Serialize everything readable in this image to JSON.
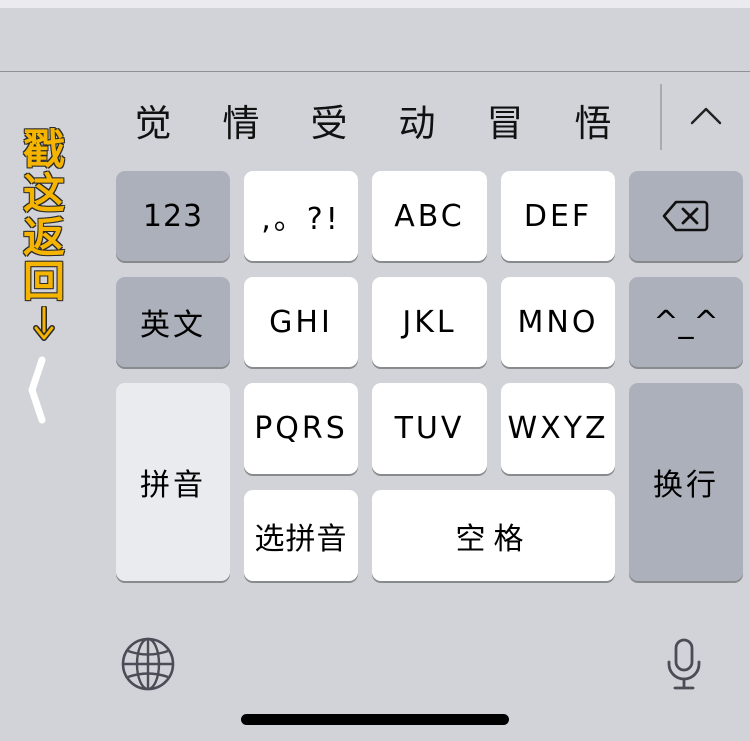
{
  "candidates": [
    "觉",
    "情",
    "受",
    "动",
    "冒",
    "悟"
  ],
  "candidate_expand_icon": "chevron-up-icon",
  "side_hint": {
    "text": "戳这返回",
    "chars": [
      "戳",
      "这",
      "返",
      "回"
    ],
    "arrow_icon": "arrow-down-icon",
    "chevron_icon": "chevron-left-icon",
    "color": "#f4b400"
  },
  "keys": {
    "numbers": "123",
    "punct": ",。?!",
    "abc": "ABC",
    "def": "DEF",
    "delete_icon": "delete-icon",
    "english": "英文",
    "ghi": "GHI",
    "jkl": "JKL",
    "mno": "MNO",
    "emoticon": "^_^",
    "pinyin": "拼音",
    "pqrs": "PQRS",
    "tuv": "TUV",
    "wxyz": "WXYZ",
    "return": "换行",
    "select_pinyin": "选拼音",
    "space": "空格"
  },
  "bottom_icons": {
    "globe": "globe-icon",
    "mic": "microphone-icon"
  },
  "colors": {
    "keyboard_bg": "#d1d3d9",
    "letter_key": "#ffffff",
    "function_key": "#abb0ba",
    "hint": "#f4b400"
  }
}
